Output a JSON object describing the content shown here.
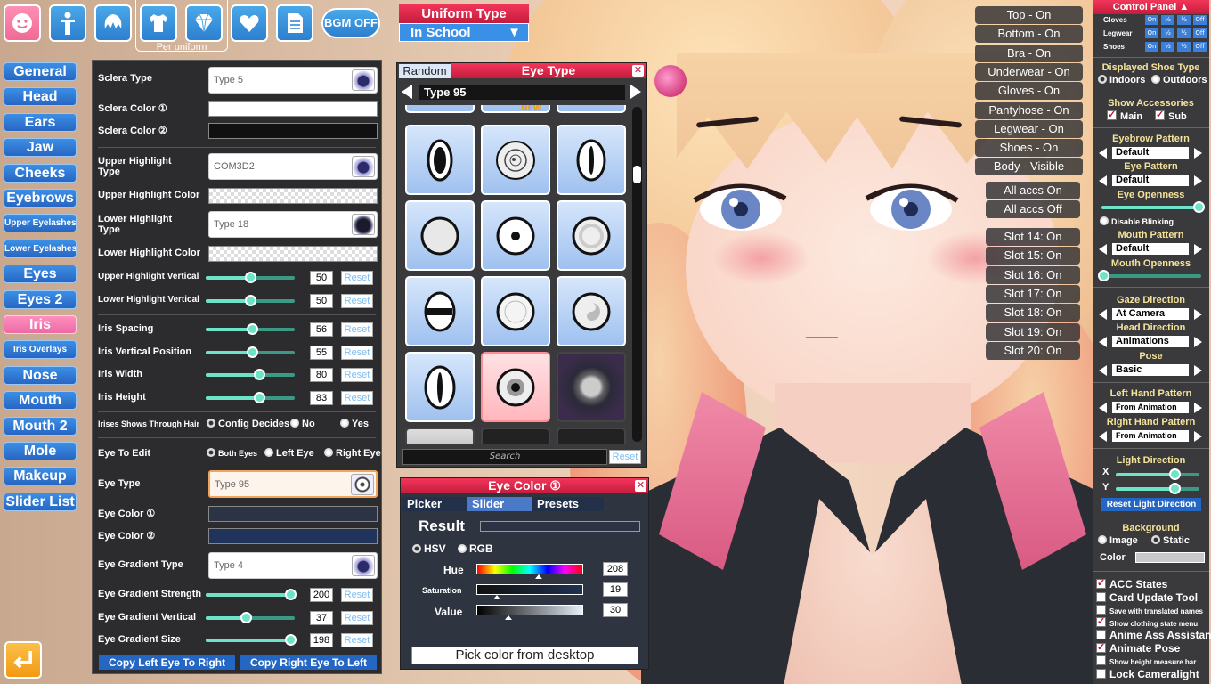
{
  "top_icons": [
    {
      "icon": "face-icon"
    },
    {
      "icon": "body-icon"
    },
    {
      "icon": "hair-icon"
    },
    {
      "icon": "clothing-icon"
    },
    {
      "icon": "accessory-diamond-icon"
    },
    {
      "icon": "heart-icon"
    },
    {
      "icon": "document-icon"
    }
  ],
  "per_uniform_label": "Per uniform",
  "bgm_label": "BGM OFF",
  "uniform_type": {
    "label": "Uniform Type",
    "value": "In School"
  },
  "nav": [
    {
      "label": "General"
    },
    {
      "label": "Head"
    },
    {
      "label": "Ears"
    },
    {
      "label": "Jaw"
    },
    {
      "label": "Cheeks"
    },
    {
      "label": "Eyebrows"
    },
    {
      "label": "Upper Eyelashes"
    },
    {
      "label": "Lower Eyelashes"
    },
    {
      "label": "Eyes"
    },
    {
      "label": "Eyes 2"
    },
    {
      "label": "Iris"
    },
    {
      "label": "Iris Overlays"
    },
    {
      "label": "Nose"
    },
    {
      "label": "Mouth"
    },
    {
      "label": "Mouth 2"
    },
    {
      "label": "Mole"
    },
    {
      "label": "Makeup"
    },
    {
      "label": "Slider List"
    }
  ],
  "panel": {
    "sclera_type": {
      "label": "Sclera Type",
      "value": "Type 5"
    },
    "sclera_color_1": "Sclera Color ①",
    "sclera_color_2": "Sclera Color ②",
    "upper_highlight_type": {
      "label": "Upper Highlight Type",
      "value": "COM3D2"
    },
    "upper_highlight_color": "Upper Highlight Color",
    "lower_highlight_type": {
      "label": "Lower Highlight Type",
      "value": "Type 18"
    },
    "lower_highlight_color": "Lower Highlight Color",
    "sliders1": [
      {
        "label": "Upper Highlight Vertical",
        "value": "50",
        "level": 0.5
      },
      {
        "label": "Lower Highlight Vertical",
        "value": "50",
        "level": 0.5
      }
    ],
    "sliders2": [
      {
        "label": "Iris Spacing",
        "value": "56",
        "level": 0.52
      },
      {
        "label": "Iris Vertical Position",
        "value": "55",
        "level": 0.52
      },
      {
        "label": "Iris Width",
        "value": "80",
        "level": 0.6
      },
      {
        "label": "Iris Height",
        "value": "83",
        "level": 0.6
      }
    ],
    "reset_label": "Reset",
    "irises_through_hair": {
      "label": "Irises Shows Through Hair",
      "options": [
        "Config Decides",
        "No",
        "Yes"
      ]
    },
    "eye_to_edit": {
      "label": "Eye To Edit",
      "options": [
        "Both Eyes",
        "Left Eye",
        "Right Eye"
      ]
    },
    "eye_type": {
      "label": "Eye Type",
      "value": "Type 95"
    },
    "eye_color_1": "Eye Color ①",
    "eye_color_2": "Eye Color ②",
    "eye_gradient_type": {
      "label": "Eye Gradient Type",
      "value": "Type 4"
    },
    "sliders3": [
      {
        "label": "Eye Gradient Strength",
        "value": "200",
        "level": 0.95
      },
      {
        "label": "Eye Gradient Vertical",
        "value": "37",
        "level": 0.45
      },
      {
        "label": "Eye Gradient Size",
        "value": "198",
        "level": 0.95
      }
    ],
    "copy_left": "Copy Left Eye To Right",
    "copy_right": "Copy Right Eye To Left"
  },
  "eye_type_window": {
    "random_label": "Random",
    "title": "Eye Type",
    "current": "Type 95",
    "new_badge": "NEW",
    "search_placeholder": "Search",
    "reset_label": "Reset"
  },
  "eye_color_window": {
    "title": "Eye Color ①",
    "tabs": [
      "Picker",
      "Slider",
      "Presets"
    ],
    "result_label": "Result",
    "modes": [
      "HSV",
      "RGB"
    ],
    "hue": {
      "label": "Hue",
      "value": "208",
      "level": 0.58
    },
    "saturation": {
      "label": "Saturation",
      "value": "19",
      "level": 0.19
    },
    "value": {
      "label": "Value",
      "value": "30",
      "level": 0.3
    },
    "pick_button": "Pick color from desktop"
  },
  "state_buttons": [
    "Top - On",
    "Bottom - On",
    "Bra - On",
    "Underwear - On",
    "Gloves - On",
    "Pantyhose - On",
    "Legwear - On",
    "Shoes - On",
    "Body - Visible"
  ],
  "accs_buttons": [
    "All accs On",
    "All accs Off"
  ],
  "slot_buttons": [
    "Slot 14: On",
    "Slot 15: On",
    "Slot 16: On",
    "Slot 17: On",
    "Slot 18: On",
    "Slot 19: On",
    "Slot 20: On"
  ],
  "control_panel": {
    "title": "Control Panel",
    "rows": [
      {
        "label": "Gloves"
      },
      {
        "label": "Legwear"
      },
      {
        "label": "Shoes"
      }
    ],
    "mini_buttons": [
      "On",
      "½",
      "½",
      "Off"
    ],
    "displayed_shoe_type": {
      "label": "Displayed Shoe Type",
      "options": [
        "Indoors",
        "Outdoors"
      ]
    },
    "show_accessories": {
      "label": "Show Accessories",
      "options": [
        "Main",
        "Sub"
      ]
    },
    "eyebrow_pattern": {
      "label": "Eyebrow Pattern",
      "value": "Default"
    },
    "eye_pattern": {
      "label": "Eye Pattern",
      "value": "Default"
    },
    "eye_openness": {
      "label": "Eye Openness",
      "level": 0.97
    },
    "disable_blinking": "Disable Blinking",
    "mouth_pattern": {
      "label": "Mouth Pattern",
      "value": "Default"
    },
    "mouth_openness": {
      "label": "Mouth Openness",
      "level": 0.02
    },
    "gaze_direction": {
      "label": "Gaze Direction",
      "value": "At Camera"
    },
    "head_direction": {
      "label": "Head Direction",
      "value": "Animations"
    },
    "pose": {
      "label": "Pose",
      "value": "Basic"
    },
    "left_hand": {
      "label": "Left Hand Pattern",
      "value": "From Animation"
    },
    "right_hand": {
      "label": "Right Hand Pattern",
      "value": "From Animation"
    },
    "light_direction": {
      "label": "Light Direction",
      "x_label": "X",
      "y_label": "Y",
      "x_level": 0.7,
      "y_level": 0.7
    },
    "reset_light": "Reset Light Direction",
    "background": {
      "label": "Background",
      "options": [
        "Image",
        "Static"
      ],
      "color_label": "Color"
    },
    "checks": [
      {
        "label": "ACC States",
        "on": true,
        "tiny": false
      },
      {
        "label": "Card Update Tool",
        "on": false,
        "tiny": false
      },
      {
        "label": "Save with translated names",
        "on": false,
        "tiny": true
      },
      {
        "label": "Show clothing state menu",
        "on": true,
        "tiny": true
      },
      {
        "label": "Anime Ass Assistant",
        "on": false,
        "tiny": false
      },
      {
        "label": "Animate Pose",
        "on": true,
        "tiny": false
      },
      {
        "label": "Show height measure bar",
        "on": false,
        "tiny": true
      },
      {
        "label": "Lock Cameralight",
        "on": false,
        "tiny": false
      }
    ]
  },
  "colors": {
    "nav_blue": "#2d73d2",
    "nav_active_pink": "#ee6fa8",
    "window_red": "#d92447",
    "slider_teal": "#6de3c7",
    "cp_title_yellow": "#f5e39a"
  }
}
